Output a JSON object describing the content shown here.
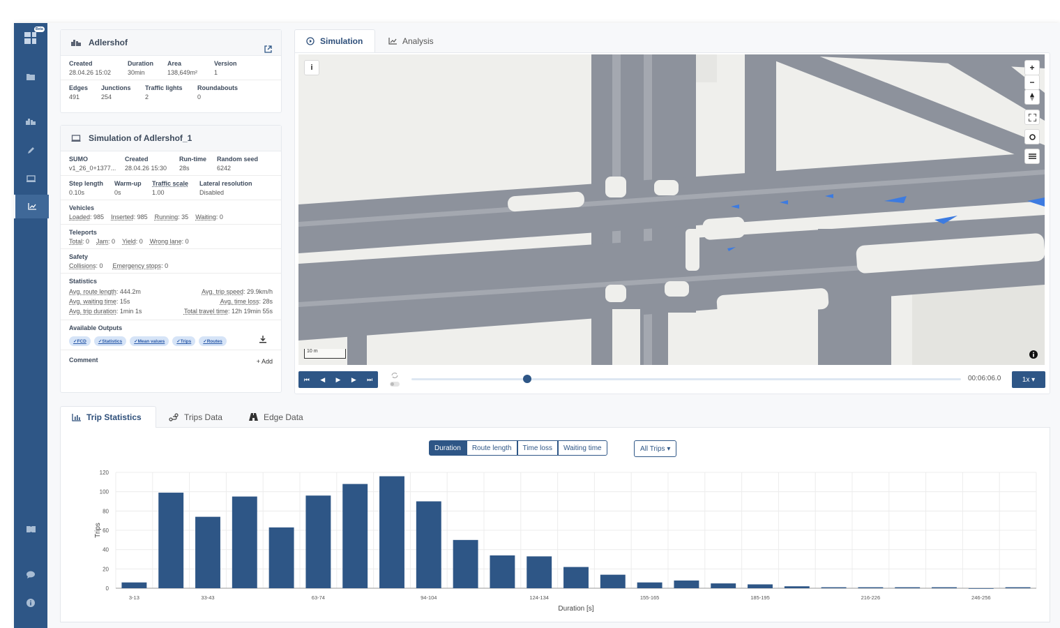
{
  "network": {
    "title": "Adlershof",
    "fields1": [
      {
        "label": "Created",
        "value": "28.04.26 15:02"
      },
      {
        "label": "Duration",
        "value": "30min"
      },
      {
        "label": "Area",
        "value": "138,649m²"
      },
      {
        "label": "Version",
        "value": "1"
      }
    ],
    "fields2": [
      {
        "label": "Edges",
        "value": "491"
      },
      {
        "label": "Junctions",
        "value": "254"
      },
      {
        "label": "Traffic lights",
        "value": "2"
      },
      {
        "label": "Roundabouts",
        "value": "0"
      }
    ]
  },
  "simulation": {
    "title": "Simulation of Adlershof_1",
    "row1": [
      {
        "label": "SUMO",
        "value": "v1_26_0+1377..."
      },
      {
        "label": "Created",
        "value": "28.04.26 15:30"
      },
      {
        "label": "Run-time",
        "value": "28s"
      },
      {
        "label": "Random seed",
        "value": "6242"
      }
    ],
    "row2": [
      {
        "label": "Step length",
        "value": "0.10s"
      },
      {
        "label": "Warm-up",
        "value": "0s"
      },
      {
        "label": "Traffic scale",
        "value": "1.00"
      },
      {
        "label": "Lateral resolution",
        "value": "Disabled"
      }
    ],
    "vehicles_label": "Vehicles",
    "vehicles": [
      {
        "k": "Loaded",
        "v": ": 985"
      },
      {
        "k": "Inserted",
        "v": ": 985"
      },
      {
        "k": "Running",
        "v": ": 35"
      },
      {
        "k": "Waiting",
        "v": ": 0"
      }
    ],
    "teleports_label": "Teleports",
    "teleports": [
      {
        "k": "Total",
        "v": ": 0"
      },
      {
        "k": "Jam",
        "v": ": 0"
      },
      {
        "k": "Yield",
        "v": ": 0"
      },
      {
        "k": "Wrong lane",
        "v": ": 0"
      }
    ],
    "safety_label": "Safety",
    "safety": [
      {
        "k": "Collisions",
        "v": ": 0"
      },
      {
        "k": "Emergency stops",
        "v": ": 0"
      }
    ],
    "statistics_label": "Statistics",
    "stats_left": [
      {
        "k": "Avg. route length",
        "v": ": 444.2m"
      },
      {
        "k": "Avg. waiting time",
        "v": ": 15s"
      },
      {
        "k": "Avg. trip duration",
        "v": ": 1min 1s"
      }
    ],
    "stats_right": [
      {
        "k": "Avg. trip speed",
        "v": ": 29.9km/h"
      },
      {
        "k": "Avg. time loss",
        "v": ": 28s"
      },
      {
        "k": "Total travel time",
        "v": ": 12h 19min 55s"
      }
    ],
    "outputs_label": "Available Outputs",
    "outputs": [
      "✓FCD",
      "✓Statistics",
      "✓Mean values",
      "✓Trips",
      "✓Routes"
    ],
    "comment_label": "Comment",
    "add_label": "+ Add"
  },
  "tabs": {
    "simulation": "Simulation",
    "analysis": "Analysis"
  },
  "map": {
    "info": "i",
    "scale": "10 m",
    "zoom_in": "+",
    "zoom_out": "−"
  },
  "player": {
    "time": "00:06:06.0",
    "speed": "1x ▾"
  },
  "bottom_tabs": {
    "trip_stats": "Trip Statistics",
    "trips_data": "Trips Data",
    "edge_data": "Edge Data"
  },
  "metrics": [
    "Duration",
    "Route length",
    "Time loss",
    "Waiting time"
  ],
  "filter": "All Trips ▾",
  "colors": {
    "primary": "#2e5686",
    "sidebar": "#2e5686",
    "road": "#8d929c",
    "lane_light": "#b8bcc4",
    "vehicle": "#3d7be0"
  },
  "chart_data": {
    "type": "bar",
    "categories": [
      "3-13",
      "",
      "33-43",
      "",
      "",
      "63-74",
      "",
      "",
      "94-104",
      "",
      "",
      "124-134",
      "",
      "",
      "155-165",
      "",
      "",
      "185-195",
      "",
      "",
      "216-226",
      "",
      "",
      "246-256",
      ""
    ],
    "values": [
      6,
      99,
      74,
      95,
      63,
      96,
      108,
      116,
      90,
      50,
      34,
      33,
      22,
      14,
      6,
      8,
      5,
      4,
      2,
      1,
      1,
      1,
      1,
      0,
      1
    ],
    "xlabel": "Duration [s]",
    "ylabel": "Trips",
    "ylim": [
      0,
      120
    ],
    "yticks": [
      0,
      20,
      40,
      60,
      80,
      100,
      120
    ],
    "grid": true
  }
}
